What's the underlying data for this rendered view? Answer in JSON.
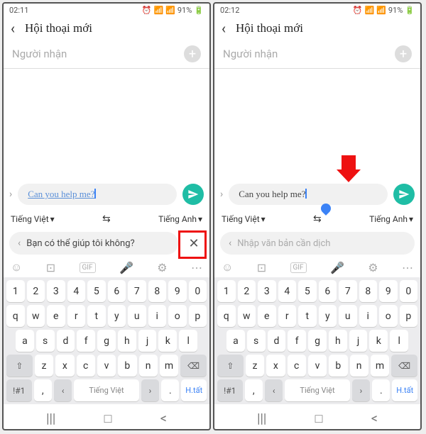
{
  "left": {
    "status": {
      "time": "02:11",
      "battery": "91%"
    },
    "header": {
      "title": "Hội thoại mới"
    },
    "recipient": {
      "placeholder": "Người nhận"
    },
    "message": {
      "text": "Can you help me?"
    },
    "translate": {
      "from": "Tiếng Việt",
      "to": "Tiếng Anh"
    },
    "edit": {
      "text": "Bạn có thể giúp tôi không?"
    }
  },
  "right": {
    "status": {
      "time": "02:12",
      "battery": "91%"
    },
    "header": {
      "title": "Hội thoại mới"
    },
    "recipient": {
      "placeholder": "Người nhận"
    },
    "message": {
      "text": "Can you help me?"
    },
    "translate": {
      "from": "Tiếng Việt",
      "to": "Tiếng Anh"
    },
    "edit": {
      "placeholder": "Nhập văn bản cần dịch"
    }
  },
  "keyboard": {
    "row1": [
      "1",
      "2",
      "3",
      "4",
      "5",
      "6",
      "7",
      "8",
      "9",
      "0"
    ],
    "row2": [
      "q",
      "w",
      "e",
      "r",
      "t",
      "y",
      "u",
      "i",
      "o",
      "p"
    ],
    "row3": [
      "a",
      "s",
      "d",
      "f",
      "g",
      "h",
      "j",
      "k",
      "l"
    ],
    "row4": [
      "z",
      "x",
      "c",
      "v",
      "b",
      "n",
      "m"
    ],
    "bottom": {
      "sym": "!#1",
      "comma": ",",
      "left": "‹",
      "space": "Tiếng Việt",
      "right": "›",
      "dot": ".",
      "enter": "H.tất"
    }
  }
}
